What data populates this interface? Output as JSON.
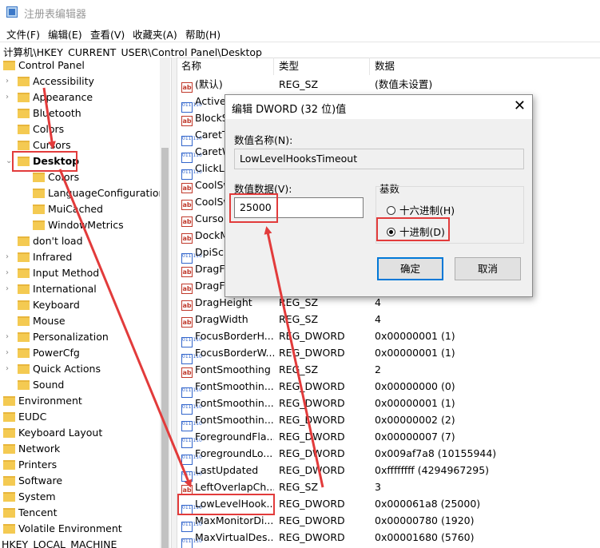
{
  "window": {
    "title": "注册表编辑器"
  },
  "menu": [
    "文件(F)",
    "编辑(E)",
    "查看(V)",
    "收藏夹(A)",
    "帮助(H)"
  ],
  "address": "计算机\\HKEY_CURRENT_USER\\Control Panel\\Desktop",
  "tree": [
    {
      "label": "Control Panel",
      "indent": 0,
      "expander": "",
      "highlight": false
    },
    {
      "label": "Accessibility",
      "indent": 1,
      "expander": ">",
      "highlight": false
    },
    {
      "label": "Appearance",
      "indent": 1,
      "expander": ">",
      "highlight": false
    },
    {
      "label": "Bluetooth",
      "indent": 1,
      "expander": "",
      "highlight": false
    },
    {
      "label": "Colors",
      "indent": 1,
      "expander": "",
      "highlight": false
    },
    {
      "label": "Cursors",
      "indent": 1,
      "expander": "",
      "highlight": false
    },
    {
      "label": "Desktop",
      "indent": 1,
      "expander": "v",
      "highlight": true
    },
    {
      "label": "Colors",
      "indent": 2,
      "expander": "",
      "highlight": false
    },
    {
      "label": "LanguageConfiguration",
      "indent": 2,
      "expander": "",
      "highlight": false
    },
    {
      "label": "MuiCached",
      "indent": 2,
      "expander": "",
      "highlight": false
    },
    {
      "label": "WindowMetrics",
      "indent": 2,
      "expander": "",
      "highlight": false
    },
    {
      "label": "don't load",
      "indent": 1,
      "expander": "",
      "highlight": false
    },
    {
      "label": "Infrared",
      "indent": 1,
      "expander": ">",
      "highlight": false
    },
    {
      "label": "Input Method",
      "indent": 1,
      "expander": ">",
      "highlight": false
    },
    {
      "label": "International",
      "indent": 1,
      "expander": ">",
      "highlight": false
    },
    {
      "label": "Keyboard",
      "indent": 1,
      "expander": "",
      "highlight": false
    },
    {
      "label": "Mouse",
      "indent": 1,
      "expander": "",
      "highlight": false
    },
    {
      "label": "Personalization",
      "indent": 1,
      "expander": ">",
      "highlight": false
    },
    {
      "label": "PowerCfg",
      "indent": 1,
      "expander": ">",
      "highlight": false
    },
    {
      "label": "Quick Actions",
      "indent": 1,
      "expander": ">",
      "highlight": false
    },
    {
      "label": "Sound",
      "indent": 1,
      "expander": "",
      "highlight": false
    },
    {
      "label": "Environment",
      "indent": 0,
      "expander": "",
      "highlight": false
    },
    {
      "label": "EUDC",
      "indent": 0,
      "expander": "",
      "highlight": false
    },
    {
      "label": "Keyboard Layout",
      "indent": 0,
      "expander": "",
      "highlight": false
    },
    {
      "label": "Network",
      "indent": 0,
      "expander": "",
      "highlight": false
    },
    {
      "label": "Printers",
      "indent": 0,
      "expander": "",
      "highlight": false
    },
    {
      "label": "Software",
      "indent": 0,
      "expander": "",
      "highlight": false
    },
    {
      "label": "System",
      "indent": 0,
      "expander": "",
      "highlight": false
    },
    {
      "label": "Tencent",
      "indent": 0,
      "expander": "",
      "highlight": false
    },
    {
      "label": "Volatile Environment",
      "indent": 0,
      "expander": "",
      "highlight": false
    },
    {
      "label": "HKEY_LOCAL_MACHINE",
      "indent": -1,
      "expander": "",
      "highlight": false
    }
  ],
  "columns": [
    "名称",
    "类型",
    "数据"
  ],
  "values": [
    {
      "name": "(默认)",
      "type": "REG_SZ",
      "data": "(数值未设置)",
      "icon": "sz"
    },
    {
      "name": "ActiveW",
      "type": "",
      "data": "",
      "icon": "dw"
    },
    {
      "name": "BlockS",
      "type": "",
      "data": "",
      "icon": "sz"
    },
    {
      "name": "CaretT",
      "type": "",
      "data": "",
      "icon": "dw"
    },
    {
      "name": "CaretW",
      "type": "",
      "data": "",
      "icon": "dw"
    },
    {
      "name": "ClickLo",
      "type": "",
      "data": "",
      "icon": "dw"
    },
    {
      "name": "CoolSw",
      "type": "",
      "data": "",
      "icon": "sz"
    },
    {
      "name": "CoolSw",
      "type": "",
      "data": "",
      "icon": "sz"
    },
    {
      "name": "Cursor",
      "type": "",
      "data": "",
      "icon": "sz"
    },
    {
      "name": "DockM",
      "type": "",
      "data": "",
      "icon": "sz"
    },
    {
      "name": "DpiSc",
      "type": "",
      "data": "",
      "icon": "dw"
    },
    {
      "name": "DragF",
      "type": "",
      "data": "",
      "icon": "sz"
    },
    {
      "name": "DragF",
      "type": "",
      "data": "",
      "icon": "sz"
    },
    {
      "name": "DragHeight",
      "type": "REG_SZ",
      "data": "4",
      "icon": "sz"
    },
    {
      "name": "DragWidth",
      "type": "REG_SZ",
      "data": "4",
      "icon": "sz"
    },
    {
      "name": "FocusBorderH...",
      "type": "REG_DWORD",
      "data": "0x00000001 (1)",
      "icon": "dw"
    },
    {
      "name": "FocusBorderW...",
      "type": "REG_DWORD",
      "data": "0x00000001 (1)",
      "icon": "dw"
    },
    {
      "name": "FontSmoothing",
      "type": "REG_SZ",
      "data": "2",
      "icon": "sz"
    },
    {
      "name": "FontSmoothin...",
      "type": "REG_DWORD",
      "data": "0x00000000 (0)",
      "icon": "dw"
    },
    {
      "name": "FontSmoothin...",
      "type": "REG_DWORD",
      "data": "0x00000001 (1)",
      "icon": "dw"
    },
    {
      "name": "FontSmoothin...",
      "type": "REG_DWORD",
      "data": "0x00000002 (2)",
      "icon": "dw"
    },
    {
      "name": "ForegroundFla...",
      "type": "REG_DWORD",
      "data": "0x00000007 (7)",
      "icon": "dw"
    },
    {
      "name": "ForegroundLo...",
      "type": "REG_DWORD",
      "data": "0x009af7a8 (10155944)",
      "icon": "dw"
    },
    {
      "name": "LastUpdated",
      "type": "REG_DWORD",
      "data": "0xffffffff (4294967295)",
      "icon": "dw"
    },
    {
      "name": "LeftOverlapCh...",
      "type": "REG_SZ",
      "data": "3",
      "icon": "sz"
    },
    {
      "name": "LowLevelHook...",
      "type": "REG_DWORD",
      "data": "0x000061a8 (25000)",
      "icon": "dw"
    },
    {
      "name": "MaxMonitorDi...",
      "type": "REG_DWORD",
      "data": "0x00000780 (1920)",
      "icon": "dw"
    },
    {
      "name": "MaxVirtualDes...",
      "type": "REG_DWORD",
      "data": "0x00001680 (5760)",
      "icon": "dw"
    }
  ],
  "dialog": {
    "title": "编辑 DWORD (32 位)值",
    "close_glyph": "✕",
    "name_label": "数值名称(N):",
    "name_value": "LowLevelHooksTimeout",
    "data_label": "数值数据(V):",
    "data_value": "25000",
    "base_label": "基数",
    "hex_label": "十六进制(H)",
    "dec_label": "十进制(D)",
    "selected_base": "dec",
    "ok_label": "确定",
    "cancel_label": "取消"
  },
  "annotation_color": "#e23b3b",
  "icons": {
    "folder": "folder-icon",
    "string_value": "string-value-icon",
    "dword_value": "dword-value-icon"
  }
}
